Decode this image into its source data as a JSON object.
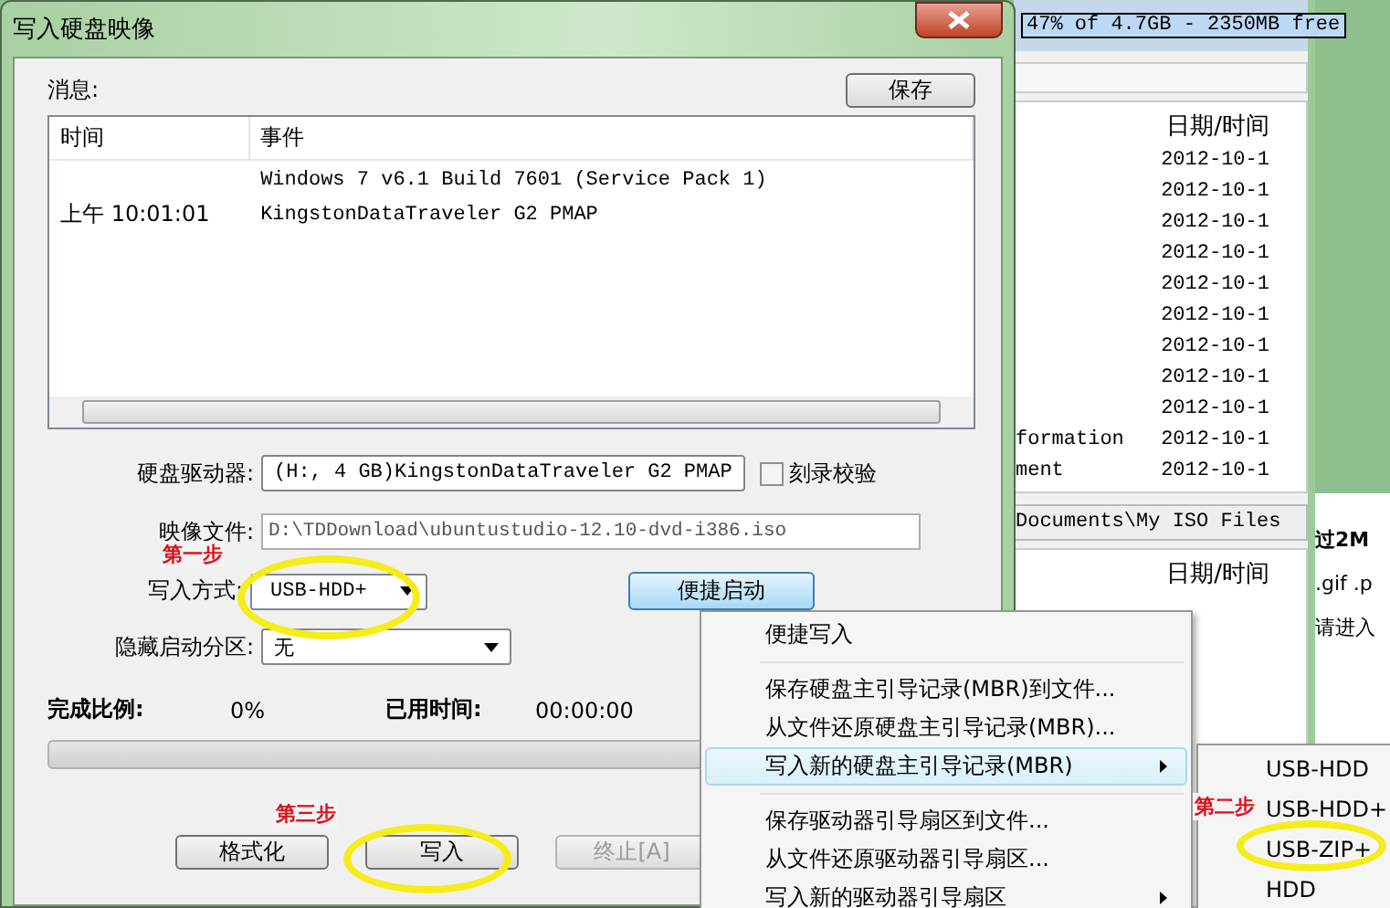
{
  "dialog": {
    "title": "写入硬盘映像",
    "messages_label": "消息:",
    "save_button": "保存",
    "log": {
      "columns": [
        "时间",
        "事件"
      ],
      "rows": [
        {
          "time": "",
          "event": "Windows 7 v6.1 Build 7601 (Service Pack 1)"
        },
        {
          "time": "上午 10:01:01",
          "event": "KingstonDataTraveler G2 PMAP"
        }
      ]
    },
    "drive": {
      "label": "硬盘驱动器:",
      "value": "(H:, 4 GB)KingstonDataTraveler G2 PMAP"
    },
    "verify": {
      "label": "刻录校验",
      "checked": false
    },
    "image_file": {
      "label": "映像文件:",
      "value": "D:\\TDDownload\\ubuntustudio-12.10-dvd-i386.iso"
    },
    "write_mode": {
      "label": "写入方式:",
      "value": "USB-HDD+"
    },
    "quick_boot_button": "便捷启动",
    "hide_partition": {
      "label": "隐藏启动分区:",
      "value": "无"
    },
    "progress": {
      "label": "完成比例:",
      "value": "0%",
      "elapsed_label": "已用时间:",
      "elapsed": "00:00:00",
      "level": 0
    },
    "buttons": [
      {
        "label": "格式化",
        "disabled": false
      },
      {
        "label": "写入",
        "disabled": false
      },
      {
        "label": "终止[A]",
        "disabled": true
      }
    ]
  },
  "background_window": {
    "capacity": "47% of 4.7GB - 2350MB free",
    "top_list": {
      "column": "日期/时间",
      "rows": [
        {
          "name": "",
          "date": "2012-10-1"
        },
        {
          "name": "",
          "date": "2012-10-1"
        },
        {
          "name": "",
          "date": "2012-10-1"
        },
        {
          "name": "",
          "date": "2012-10-1"
        },
        {
          "name": "",
          "date": "2012-10-1"
        },
        {
          "name": "",
          "date": "2012-10-1"
        },
        {
          "name": "",
          "date": "2012-10-1"
        },
        {
          "name": "",
          "date": "2012-10-1"
        },
        {
          "name": "",
          "date": "2012-10-1"
        },
        {
          "name": "formation",
          "date": "2012-10-1"
        },
        {
          "name": "ment",
          "date": "2012-10-1"
        }
      ]
    },
    "path": "Documents\\My ISO Files",
    "bottom_list_column": "日期/时间"
  },
  "side_panel": {
    "texts": [
      "过2M",
      ".gif .p",
      "请进入"
    ]
  },
  "menu": {
    "items": [
      {
        "kind": "item",
        "label": "便捷写入",
        "submenu": false,
        "selected": false
      },
      {
        "kind": "separator"
      },
      {
        "kind": "item",
        "label": "保存硬盘主引导记录(MBR)到文件...",
        "submenu": false,
        "selected": false
      },
      {
        "kind": "item",
        "label": "从文件还原硬盘主引导记录(MBR)...",
        "submenu": false,
        "selected": false
      },
      {
        "kind": "item",
        "label": "写入新的硬盘主引导记录(MBR)",
        "submenu": true,
        "selected": true
      },
      {
        "kind": "separator"
      },
      {
        "kind": "item",
        "label": "保存驱动器引导扇区到文件...",
        "submenu": false,
        "selected": false
      },
      {
        "kind": "item",
        "label": "从文件还原驱动器引导扇区...",
        "submenu": false,
        "selected": false
      },
      {
        "kind": "item",
        "label": "写入新的驱动器引导扇区",
        "submenu": true,
        "selected": false
      }
    ]
  },
  "submenu": {
    "items": [
      "USB-HDD",
      "USB-HDD+",
      "USB-ZIP+",
      "HDD"
    ]
  },
  "annotations": [
    {
      "text": "第一步"
    },
    {
      "text": "第三步"
    },
    {
      "text": "第二步"
    }
  ]
}
